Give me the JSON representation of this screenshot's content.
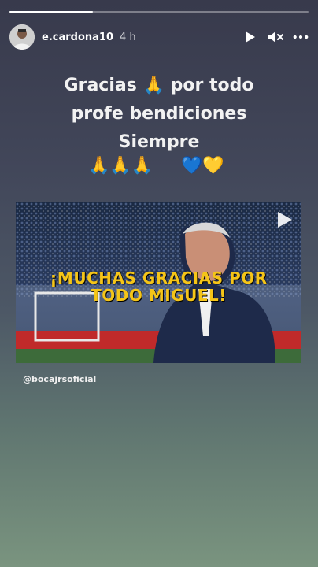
{
  "story": {
    "progress": 0.28,
    "username": "e.cardona10",
    "time": "4 h"
  },
  "icons": {
    "play": "play-icon",
    "mute": "mute-icon",
    "more": "more-options-icon"
  },
  "caption": {
    "line1": "Gracias",
    "line1b": "por todo",
    "line2": "profe bendiciones",
    "line3": "Siempre"
  },
  "emojis": {
    "pray": "🙏",
    "pray_group": "🙏🙏🙏",
    "hearts": "💙💛"
  },
  "post": {
    "title_line1": "¡MUCHAS GRACIAS POR",
    "title_line2": "TODO MIGUEL!"
  },
  "mention": "@bocajrsoficial",
  "colors": {
    "headline": "#f5c518"
  }
}
